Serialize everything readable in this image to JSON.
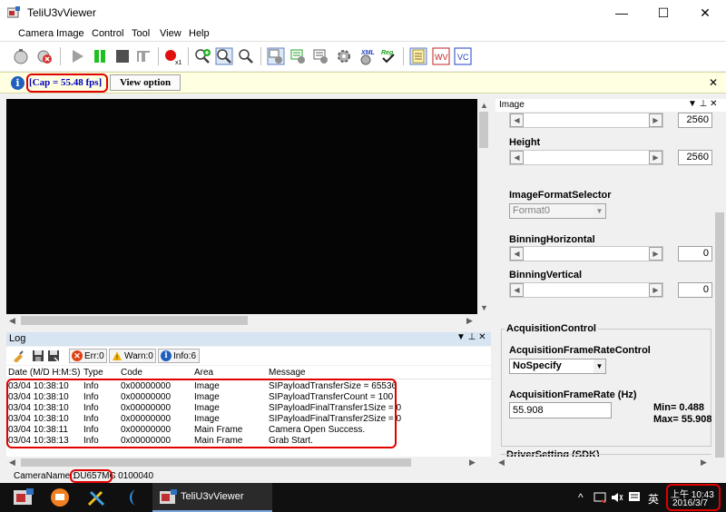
{
  "window": {
    "title": "TeliU3vViewer",
    "minimize_glyph": "—",
    "maximize_glyph": "☐",
    "close_glyph": "✕"
  },
  "menu": [
    "Camera",
    "Image",
    "Control",
    "Tool",
    "View",
    "Help"
  ],
  "toolbar": {
    "record_subscript": "x1",
    "xml_label": "XML",
    "reg_label": "Reg",
    "wv_label": "WV",
    "vc_label": "VC"
  },
  "infobar": {
    "status": "[Cap = 55.48 fps]",
    "view_option": "View option",
    "close_glyph": "✕"
  },
  "log": {
    "title": "Log",
    "err_label": "Err:0",
    "warn_label": "Warn:0",
    "info_label": "Info:6",
    "columns": [
      "Date (M/D H:M:S)",
      "Type",
      "Code",
      "Area",
      "Message"
    ],
    "rows": [
      [
        "03/04 10:38:10",
        "Info",
        "0x00000000",
        "Image",
        "SIPayloadTransferSize = 65536"
      ],
      [
        "03/04 10:38:10",
        "Info",
        "0x00000000",
        "Image",
        "SIPayloadTransferCount = 100"
      ],
      [
        "03/04 10:38:10",
        "Info",
        "0x00000000",
        "Image",
        "SIPayloadFinalTransfer1Size = 0"
      ],
      [
        "03/04 10:38:10",
        "Info",
        "0x00000000",
        "Image",
        "SIPayloadFinalTransfer2Size = 0"
      ],
      [
        "03/04 10:38:11",
        "Info",
        "0x00000000",
        "Main Frame",
        "Camera Open Success."
      ],
      [
        "03/04 10:38:13",
        "Info",
        "0x00000000",
        "Main Frame",
        "Grab Start."
      ]
    ]
  },
  "status": {
    "label": "CameraName : ",
    "model": "DU657MC",
    "serial": "- 0100040"
  },
  "panel": {
    "title": "Image",
    "pin_glyph": "▼ ⊥ ✕",
    "width_value": "2560",
    "height_label": "Height",
    "height_value": "2560",
    "format_label": "ImageFormatSelector",
    "format_value": "Format0",
    "binning_h_label": "BinningHorizontal",
    "binning_h_value": "0",
    "binning_v_label": "BinningVertical",
    "binning_v_value": "0",
    "acq_group": "AcquisitionControl",
    "fr_control_label": "AcquisitionFrameRateControl",
    "fr_control_value": "NoSpecify",
    "fr_label": "AcquisitionFrameRate (Hz)",
    "fr_value": "55.908",
    "fr_min": "Min= 0.488",
    "fr_max": "Max= 55.908",
    "driver_group": "DriverSetting (SDK)"
  },
  "taskbar": {
    "app_label": "TeliU3vViewer",
    "ime": "英",
    "time": "上午 10:43",
    "date": "2016/3/7",
    "tray_up": "^"
  },
  "colors": {
    "highlight_red": "#e00000",
    "fps_blue": "#0000c0",
    "info_yellow": "#ffffe1"
  }
}
